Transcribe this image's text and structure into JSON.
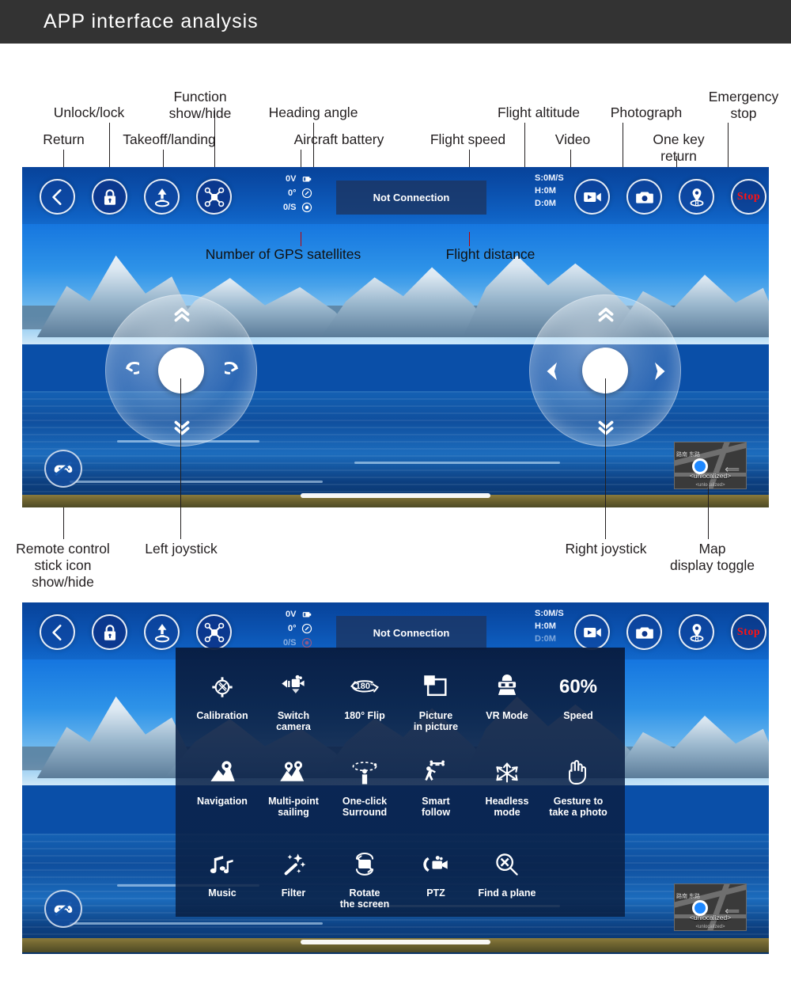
{
  "header": {
    "title": "APP interface analysis",
    "bg_color": "#333333"
  },
  "annotations": {
    "top": [
      {
        "id": "return",
        "text": "Return"
      },
      {
        "id": "unlock-lock",
        "text": "Unlock/lock"
      },
      {
        "id": "takeoff-landing",
        "text": "Takeoff/landing"
      },
      {
        "id": "function-show-hide",
        "text": "Function\nshow/hide"
      },
      {
        "id": "heading-angle",
        "text": "Heading angle"
      },
      {
        "id": "aircraft-battery",
        "text": "Aircraft battery"
      },
      {
        "id": "flight-speed",
        "text": "Flight speed"
      },
      {
        "id": "flight-altitude",
        "text": "Flight altitude"
      },
      {
        "id": "video",
        "text": "Video"
      },
      {
        "id": "photograph",
        "text": "Photograph"
      },
      {
        "id": "one-key-return",
        "text": "One key\nreturn"
      },
      {
        "id": "emergency-stop",
        "text": "Emergency\nstop"
      }
    ],
    "inside": [
      {
        "id": "gps-satellites",
        "text": "Number of GPS satellites"
      },
      {
        "id": "flight-distance",
        "text": "Flight distance"
      }
    ],
    "bottom": [
      {
        "id": "remote-stick-toggle",
        "text": "Remote control\nstick icon\nshow/hide"
      },
      {
        "id": "left-joystick",
        "text": "Left joystick"
      },
      {
        "id": "right-joystick",
        "text": "Right joystick"
      },
      {
        "id": "map-toggle",
        "text": "Map\ndisplay toggle"
      }
    ]
  },
  "hud": {
    "battery": "0V",
    "heading": "0°",
    "satellites": "0/S",
    "connection_status": "Not Connection",
    "speed": "S:0M/S",
    "altitude": "H:0M",
    "distance": "D:0M",
    "icons": {
      "battery": "battery-icon",
      "heading": "compass-icon",
      "satellites": "satellite-icon"
    }
  },
  "toolbar_left": [
    {
      "id": "return-button",
      "icon": "chevron-left-icon",
      "label": "Return"
    },
    {
      "id": "lock-button",
      "icon": "lock-icon",
      "label": "Unlock/lock"
    },
    {
      "id": "takeoff-button",
      "icon": "takeoff-icon",
      "label": "Takeoff/landing"
    },
    {
      "id": "function-button",
      "icon": "drone-icon",
      "label": "Function show/hide"
    }
  ],
  "toolbar_right": [
    {
      "id": "video-button",
      "icon": "video-camera-icon",
      "label": "Video"
    },
    {
      "id": "photo-button",
      "icon": "camera-icon",
      "label": "Photograph"
    },
    {
      "id": "return-home-button",
      "icon": "home-pin-icon",
      "label": "One key return"
    },
    {
      "id": "stop-button",
      "icon": "stop-text",
      "label": "Stop",
      "color": "#ff1111"
    }
  ],
  "joysticks": {
    "left": {
      "up": "chevrons-up-icon",
      "down": "chevrons-down-icon",
      "left": "rotate-left-icon",
      "right": "rotate-right-icon"
    },
    "right": {
      "up": "chevrons-up-icon",
      "down": "chevrons-down-icon",
      "left": "arrow-left-icon",
      "right": "arrow-right-icon"
    }
  },
  "controls": {
    "gamepad_toggle_icon": "gamepad-off-icon"
  },
  "minimap": {
    "label": "<unlocalized>",
    "sub_label": "<unlocalized>",
    "cjk": "路南\n东路",
    "dot_color": "#1e88ff"
  },
  "function_menu": {
    "rows": [
      [
        {
          "id": "calibration",
          "icon": "calibration-icon",
          "label": "Calibration"
        },
        {
          "id": "switch-camera",
          "icon": "switch-camera-icon",
          "label": "Switch\ncamera"
        },
        {
          "id": "flip-180",
          "icon": "flip-180-icon",
          "label": "180° Flip"
        },
        {
          "id": "picture-in-picture",
          "icon": "pip-icon",
          "label": "Picture\nin picture"
        },
        {
          "id": "vr-mode",
          "icon": "vr-mode-icon",
          "label": "VR Mode"
        },
        {
          "id": "speed",
          "icon": "speed-percent",
          "label": "Speed",
          "value": "60%"
        }
      ],
      [
        {
          "id": "navigation",
          "icon": "navigation-icon",
          "label": "Navigation"
        },
        {
          "id": "multi-point-sailing",
          "icon": "multi-point-icon",
          "label": "Multi-point\nsailing"
        },
        {
          "id": "one-click-surround",
          "icon": "surround-icon",
          "label": "One-click\nSurround"
        },
        {
          "id": "smart-follow",
          "icon": "follow-me-icon",
          "label": "Smart\nfollow"
        },
        {
          "id": "headless-mode",
          "icon": "headless-icon",
          "label": "Headless\nmode"
        },
        {
          "id": "gesture-photo",
          "icon": "hand-gesture-icon",
          "label": "Gesture to\ntake a photo"
        }
      ],
      [
        {
          "id": "music",
          "icon": "music-note-icon",
          "label": "Music"
        },
        {
          "id": "filter",
          "icon": "magic-wand-icon",
          "label": "Filter"
        },
        {
          "id": "rotate-screen",
          "icon": "rotate-screen-icon",
          "label": "Rotate\nthe screen"
        },
        {
          "id": "ptz",
          "icon": "ptz-icon",
          "label": "PTZ"
        },
        {
          "id": "find-plane",
          "icon": "find-plane-icon",
          "label": "Find a plane"
        }
      ]
    ]
  }
}
